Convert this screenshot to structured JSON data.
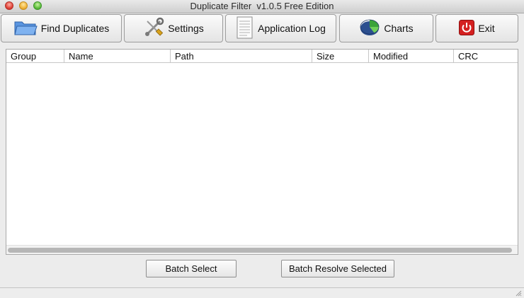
{
  "window": {
    "title": "Duplicate Filter  v1.0.5 Free Edition"
  },
  "toolbar": {
    "find_duplicates": "Find Duplicates",
    "settings": "Settings",
    "application_log": "Application Log",
    "charts": "Charts",
    "exit": "Exit"
  },
  "table": {
    "columns": [
      "Group",
      "Name",
      "Path",
      "Size",
      "Modified",
      "CRC"
    ],
    "rows": []
  },
  "actions": {
    "batch_select": "Batch Select",
    "batch_resolve_selected": "Batch Resolve Selected"
  },
  "icons": {
    "find_duplicates": "folder-icon",
    "settings": "tools-icon",
    "application_log": "document-icon",
    "charts": "pie-chart-icon",
    "exit": "power-icon"
  },
  "colors": {
    "exit_icon": "#cc1f1f",
    "folder_icon": "#3f7fd6",
    "chart_green": "#33a133",
    "chart_blue": "#2c4f8f"
  }
}
